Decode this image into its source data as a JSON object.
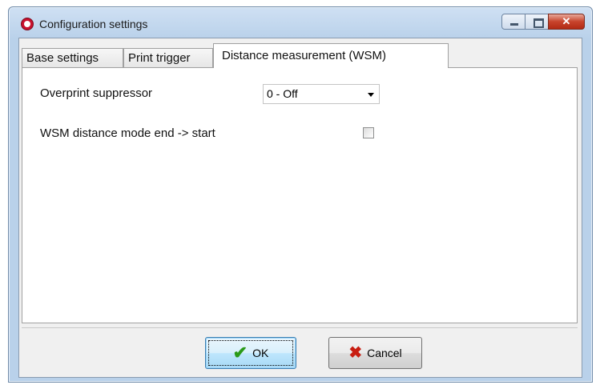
{
  "window": {
    "title": "Configuration settings",
    "app_icon": "app-logo-icon",
    "caption_buttons": [
      "minimize",
      "maximize",
      "close"
    ]
  },
  "tabs": [
    {
      "label": "Base settings",
      "active": false
    },
    {
      "label": "Print trigger",
      "active": false
    },
    {
      "label": "Distance measurement (WSM)",
      "active": true
    }
  ],
  "settings": {
    "overprint_label": "Overprint suppressor",
    "overprint_value": "0 - Off",
    "wsm_mode_label": "WSM distance mode end -> start",
    "wsm_mode_checked": false
  },
  "buttons": {
    "ok_label": "OK",
    "ok_icon": "check-icon",
    "cancel_label": "Cancel",
    "cancel_icon": "x-icon"
  },
  "colors": {
    "titlebar": "#b9d1ea",
    "close_button": "#c7432c",
    "ok_check": "#2a9a18",
    "cancel_x": "#c81d11"
  }
}
